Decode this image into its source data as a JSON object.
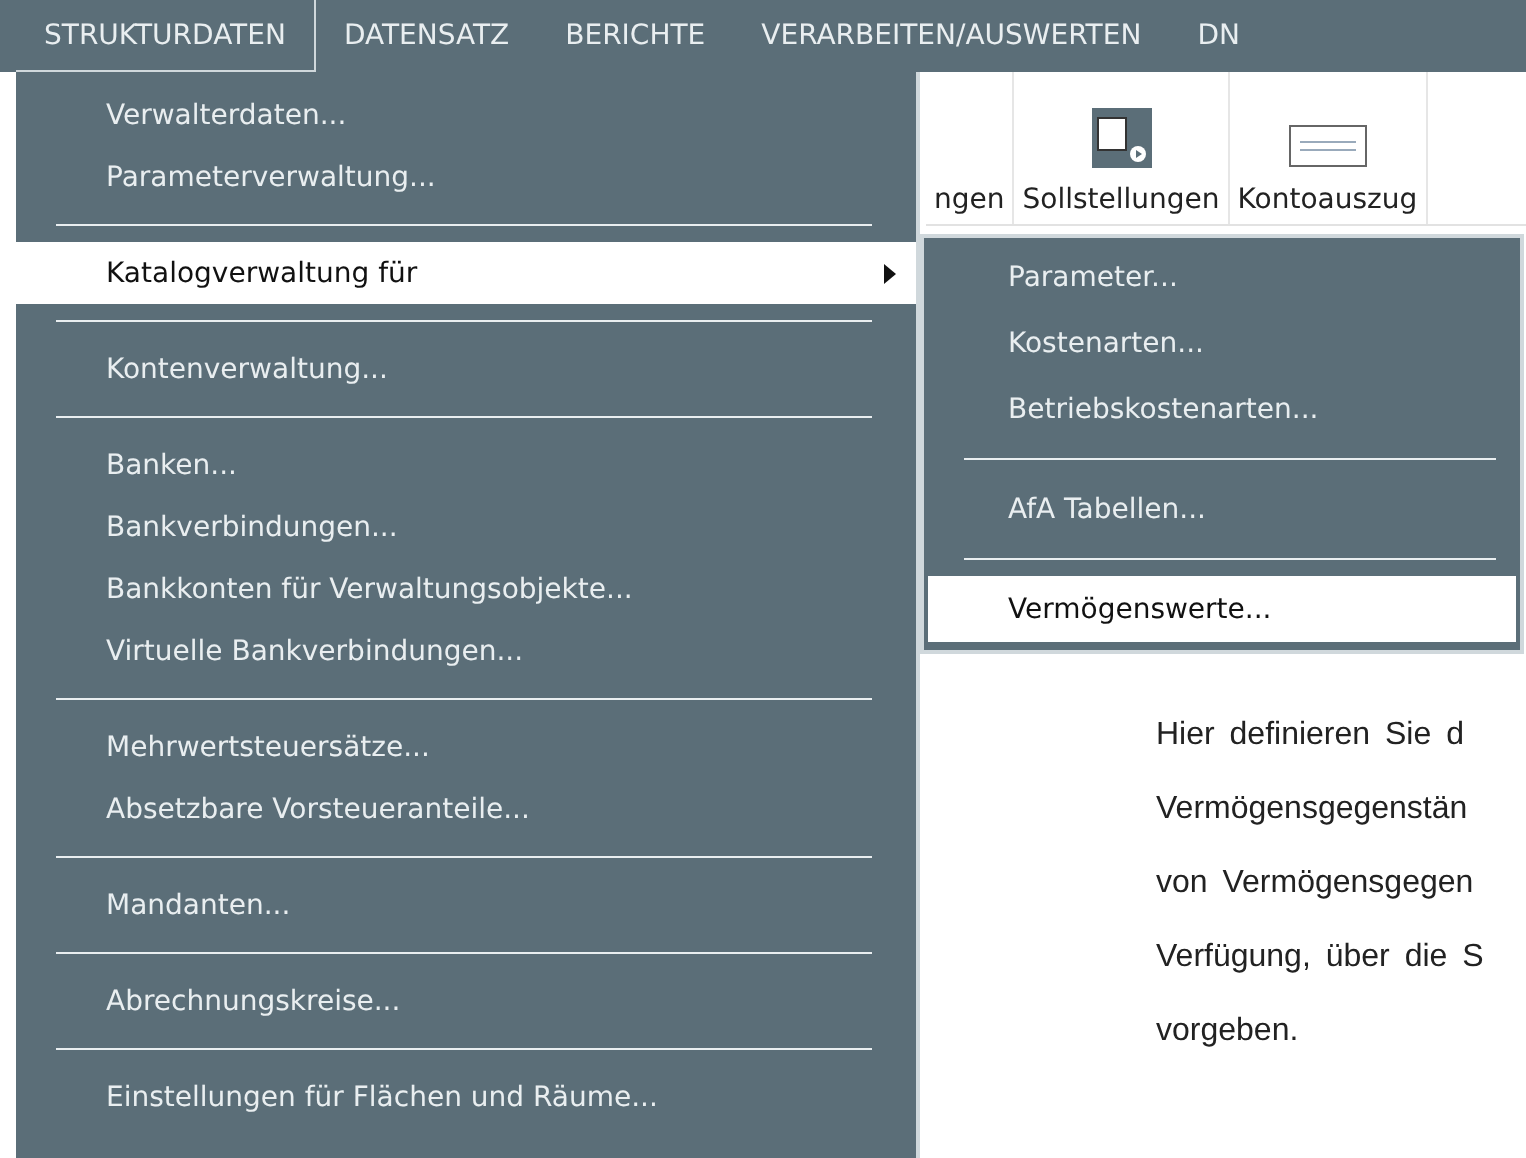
{
  "menubar": [
    {
      "label": "STRUKTURDATEN",
      "selected": true
    },
    {
      "label": "DATENSATZ",
      "selected": false
    },
    {
      "label": "BERICHTE",
      "selected": false
    },
    {
      "label": "VERARBEITEN/AUSWERTEN",
      "selected": false
    },
    {
      "label": "DN",
      "selected": false
    }
  ],
  "ribbon": [
    {
      "label": "ngen",
      "kind": "none"
    },
    {
      "label": "Sollstellungen",
      "kind": "calendar"
    },
    {
      "label": "Kontoauszug",
      "kind": "statement"
    }
  ],
  "menu": [
    {
      "kind": "item",
      "label": "Verwalterdaten...",
      "selected": false,
      "submenu": false
    },
    {
      "kind": "item",
      "label": "Parameterverwaltung...",
      "selected": false,
      "submenu": false
    },
    {
      "kind": "separator"
    },
    {
      "kind": "item",
      "label": "Katalogverwaltung für",
      "selected": true,
      "submenu": true
    },
    {
      "kind": "separator"
    },
    {
      "kind": "item",
      "label": "Kontenverwaltung...",
      "selected": false,
      "submenu": false
    },
    {
      "kind": "separator"
    },
    {
      "kind": "item",
      "label": "Banken...",
      "selected": false,
      "submenu": false
    },
    {
      "kind": "item",
      "label": "Bankverbindungen...",
      "selected": false,
      "submenu": false
    },
    {
      "kind": "item",
      "label": "Bankkonten für Verwaltungsobjekte...",
      "selected": false,
      "submenu": false
    },
    {
      "kind": "item",
      "label": "Virtuelle Bankverbindungen...",
      "selected": false,
      "submenu": false
    },
    {
      "kind": "separator"
    },
    {
      "kind": "item",
      "label": "Mehrwertsteuersätze...",
      "selected": false,
      "submenu": false
    },
    {
      "kind": "item",
      "label": "Absetzbare Vorsteueranteile...",
      "selected": false,
      "submenu": false
    },
    {
      "kind": "separator"
    },
    {
      "kind": "item",
      "label": "Mandanten...",
      "selected": false,
      "submenu": false
    },
    {
      "kind": "separator"
    },
    {
      "kind": "item",
      "label": "Abrechnungskreise...",
      "selected": false,
      "submenu": false
    },
    {
      "kind": "separator"
    },
    {
      "kind": "item",
      "label": "Einstellungen für Flächen und Räume...",
      "selected": false,
      "submenu": false
    }
  ],
  "submenu": [
    {
      "kind": "item",
      "label": "Parameter...",
      "selected": false
    },
    {
      "kind": "item",
      "label": "Kostenarten...",
      "selected": false
    },
    {
      "kind": "item",
      "label": "Betriebskostenarten...",
      "selected": false
    },
    {
      "kind": "separator"
    },
    {
      "kind": "item",
      "label": "AfA Tabellen...",
      "selected": false
    },
    {
      "kind": "separator"
    },
    {
      "kind": "item",
      "label": "Vermögenswerte...",
      "selected": true
    }
  ],
  "paragraph": [
    "Hier definieren Sie d",
    "Vermögensgegenstän",
    "von Vermögensgegen",
    "Verfügung, über die S",
    "vorgeben."
  ]
}
